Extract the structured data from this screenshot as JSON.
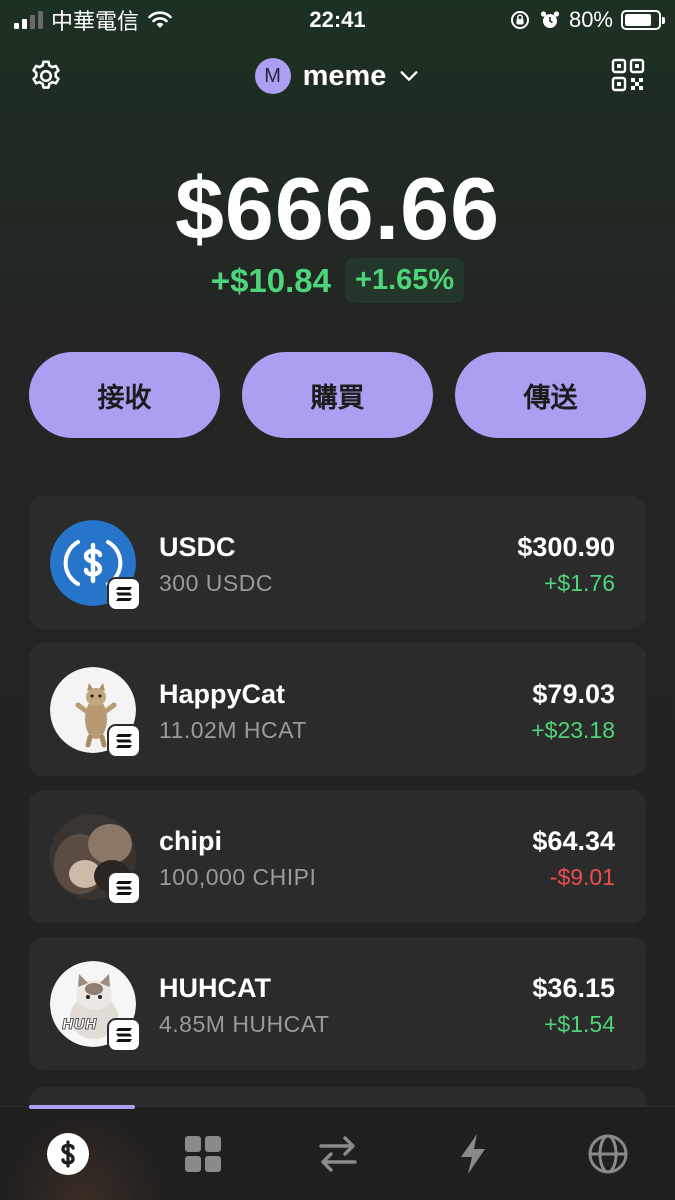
{
  "status_bar": {
    "carrier": "中華電信",
    "time": "22:41",
    "battery": "80%"
  },
  "header": {
    "avatar_initial": "M",
    "account_name": "meme"
  },
  "portfolio": {
    "balance": "$666.66",
    "change_amount": "+$10.84",
    "change_percent": "+1.65%"
  },
  "actions": [
    {
      "label": "接收"
    },
    {
      "label": "購買"
    },
    {
      "label": "傳送"
    }
  ],
  "tokens": [
    {
      "name": "USDC",
      "amount": "300 USDC",
      "value": "$300.90",
      "change": "+$1.76"
    },
    {
      "name": "HappyCat",
      "amount": "11.02M HCAT",
      "value": "$79.03",
      "change": "+$23.18"
    },
    {
      "name": "chipi",
      "amount": "100,000 CHIPI",
      "value": "$64.34",
      "change": "-$9.01"
    },
    {
      "name": "HUHCAT",
      "amount": "4.85M HUHCAT",
      "value": "$36.15",
      "change": "+$1.54"
    }
  ],
  "icons": {
    "settings": "gear-icon",
    "qr": "qr-code-icon",
    "nav": [
      "dollar-icon",
      "grid-icon",
      "swap-icon",
      "lightning-icon",
      "globe-icon"
    ]
  },
  "colors": {
    "accent": "#ab9ff2",
    "positive": "#4ed57a",
    "negative": "#eb4d4d",
    "card": "#2b2b2b",
    "usdc": "#2775ca"
  }
}
